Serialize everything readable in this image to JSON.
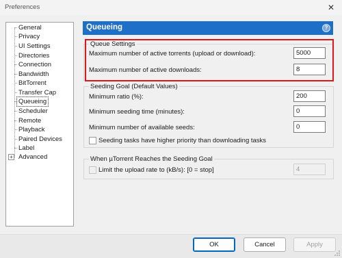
{
  "window": {
    "title": "Preferences",
    "close_glyph": "✕"
  },
  "sidebar": {
    "items": [
      {
        "label": "General"
      },
      {
        "label": "Privacy"
      },
      {
        "label": "UI Settings"
      },
      {
        "label": "Directories"
      },
      {
        "label": "Connection"
      },
      {
        "label": "Bandwidth"
      },
      {
        "label": "BitTorrent"
      },
      {
        "label": "Transfer Cap"
      },
      {
        "label": "Queueing",
        "selected": true
      },
      {
        "label": "Scheduler"
      },
      {
        "label": "Remote"
      },
      {
        "label": "Playback"
      },
      {
        "label": "Paired Devices"
      },
      {
        "label": "Label"
      },
      {
        "label": "Advanced",
        "expandable": true
      }
    ],
    "expander_glyph": "+"
  },
  "header": {
    "title": "Queueing",
    "help_glyph": "?",
    "color": "#1e6fc7"
  },
  "queue_settings": {
    "group_label": "Queue Settings",
    "max_active_torrents_label": "Maximum number of active torrents (upload or download):",
    "max_active_torrents_value": "5000",
    "max_active_downloads_label": "Maximum number of active downloads:",
    "max_active_downloads_value": "8",
    "highlight_color": "#e0151a"
  },
  "seeding_goal": {
    "group_label": "Seeding Goal (Default Values)",
    "min_ratio_label": "Minimum ratio (%):",
    "min_ratio_value": "200",
    "min_seed_time_label": "Minimum seeding time (minutes):",
    "min_seed_time_value": "0",
    "min_seeds_label": "Minimum number of available seeds:",
    "min_seeds_value": "0",
    "priority_checkbox_label": "Seeding tasks have higher priority than downloading tasks",
    "priority_checked": false
  },
  "seeding_reached": {
    "group_label": "When µTorrent Reaches the Seeding Goal",
    "limit_checkbox_label": "Limit the upload rate to (kB/s): [0 = stop]",
    "limit_checked": false,
    "limit_value": "4"
  },
  "buttons": {
    "ok": "OK",
    "cancel": "Cancel",
    "apply": "Apply"
  }
}
